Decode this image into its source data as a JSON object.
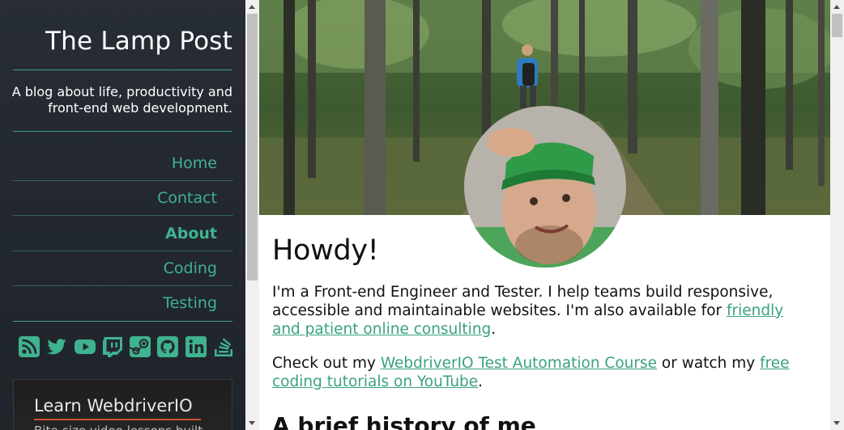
{
  "sidebar": {
    "site_title": "The Lamp Post",
    "tagline": "A blog about life, productivity and front-end web development.",
    "nav": [
      {
        "label": "Home",
        "active": false
      },
      {
        "label": "Contact",
        "active": false
      },
      {
        "label": "About",
        "active": true
      },
      {
        "label": "Coding",
        "active": false
      },
      {
        "label": "Testing",
        "active": false
      }
    ],
    "social_icons": [
      "rss-icon",
      "twitter-icon",
      "youtube-icon",
      "twitch-icon",
      "steam-icon",
      "github-icon",
      "linkedin-icon",
      "stackoverflow-icon"
    ],
    "promo": {
      "title": "Learn WebdriverIO",
      "subtitle": "Bite-size video lessons built"
    }
  },
  "main": {
    "heading": "Howdy!",
    "intro_text": "I'm a Front-end Engineer and Tester. I help teams build responsive, accessible and maintainable websites. I'm also available for ",
    "intro_link": "friendly and patient online consulting",
    "intro_end": ".",
    "check_text": "Check out my ",
    "course_link": "WebdriverIO Test Automation Course",
    "or_text": " or watch my ",
    "youtube_link": "free coding tutorials on YouTube",
    "check_end": ".",
    "history_heading": "A brief history of me"
  },
  "colors": {
    "accent": "#3aa183",
    "sidebar_bg": "#23282f",
    "text": "#111111"
  }
}
